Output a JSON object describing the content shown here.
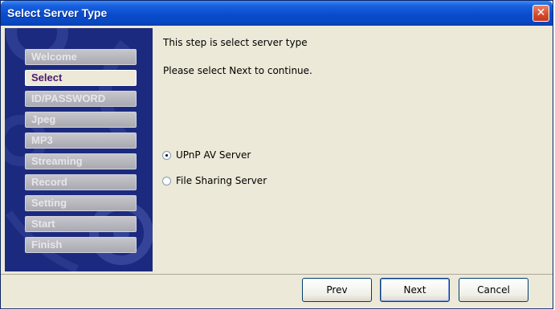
{
  "window": {
    "title": "Select Server Type",
    "close_icon": "close-icon",
    "colors": {
      "title_bar": "#0a4ccd",
      "sidebar": "#1b2a7e",
      "active_step_text": "#4b1b6e",
      "close_button": "#d54a2b"
    }
  },
  "sidebar": {
    "steps": [
      {
        "label": "Welcome",
        "active": false
      },
      {
        "label": "Select",
        "active": true
      },
      {
        "label": "ID/PASSWORD",
        "active": false
      },
      {
        "label": "Jpeg",
        "active": false
      },
      {
        "label": "MP3",
        "active": false
      },
      {
        "label": "Streaming",
        "active": false
      },
      {
        "label": "Record",
        "active": false
      },
      {
        "label": "Setting",
        "active": false
      },
      {
        "label": "Start",
        "active": false
      },
      {
        "label": "Finish",
        "active": false
      }
    ]
  },
  "content": {
    "line1": "This step is select server type",
    "line2": "Please select Next to continue.",
    "options": [
      {
        "label": "UPnP AV Server",
        "checked": true
      },
      {
        "label": "File Sharing Server",
        "checked": false
      }
    ]
  },
  "buttons": {
    "prev": "Prev",
    "next": "Next",
    "cancel": "Cancel"
  }
}
